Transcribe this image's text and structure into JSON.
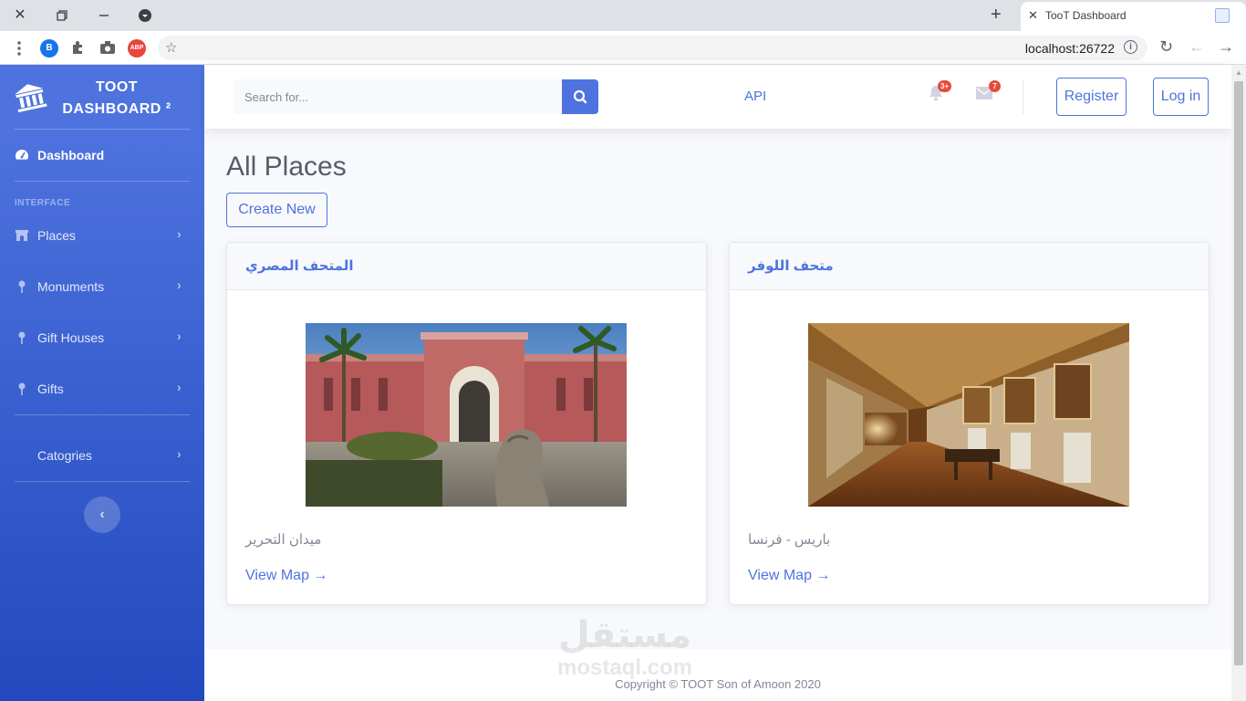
{
  "browser": {
    "tab_title": "TooT Dashboard",
    "url": "localhost:26722",
    "ext_b_label": "B",
    "ext_abp_label": "ABP",
    "info_glyph": "i",
    "star_glyph": "☆",
    "close_glyph": "✕",
    "newtab_glyph": "+",
    "reload_glyph": "↻",
    "back_glyph": "←",
    "forward_glyph": "→"
  },
  "sidebar": {
    "brand_line1": "TOOT",
    "brand_line2": "DASHBOARD ²",
    "dashboard_label": "Dashboard",
    "heading": "INTERFACE",
    "items": [
      {
        "label": "Places",
        "icon": "building-icon"
      },
      {
        "label": "Monuments",
        "icon": "pin-icon"
      },
      {
        "label": "Gift Houses",
        "icon": "pin-icon"
      },
      {
        "label": "Gifts",
        "icon": "pin-icon"
      },
      {
        "label": "Catogries",
        "icon": "none"
      }
    ],
    "chevron": "›",
    "toggle_glyph": "‹"
  },
  "topbar": {
    "search_placeholder": "Search for...",
    "api_label": "API",
    "alerts_badge": "3+",
    "messages_badge": "7",
    "register_label": "Register",
    "login_label": "Log in"
  },
  "main": {
    "page_title": "All Places",
    "create_label": "Create New",
    "cards": [
      {
        "title": "المتحف المصري",
        "subtitle": "ميدان التحرير",
        "link": "View Map →"
      },
      {
        "title": "متحف اللوفر",
        "subtitle": "باريس - فرنسا",
        "link": "View Map →"
      }
    ]
  },
  "footer": {
    "copyright": "Copyright © TOOT Son of Amoon 2020",
    "watermark_ar": "مستقل",
    "watermark_en": "mostaql.com"
  },
  "colors": {
    "primary": "#4e73df",
    "sidebar_end": "#224abe",
    "danger": "#e74a3b"
  }
}
